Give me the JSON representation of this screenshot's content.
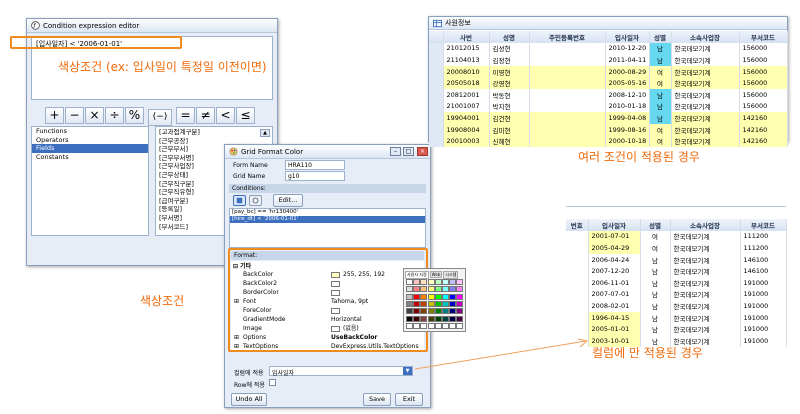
{
  "condition_editor": {
    "title": "Condition expression editor",
    "expression": "[입사일자] < '2006-01-01'",
    "operators": [
      "+",
      "−",
      "×",
      "÷",
      "%",
      "(−)",
      "=",
      "≠",
      "<",
      "≤"
    ],
    "categories": [
      "Functions",
      "Operators",
      "Fields",
      "Constants"
    ],
    "selected_category": "Fields",
    "fields": [
      "[고과접계구분]",
      "[근무공장]",
      "[근무부서]",
      "[근무부서명]",
      "[근무사업장]",
      "[근무상태]",
      "[근무직구분]",
      "[근무직유형]",
      "[급여구분]",
      "[등록일]",
      "[부서명]",
      "[부서코드]"
    ]
  },
  "grid_format": {
    "title": "Grid Format Color",
    "form_name_label": "Form Name",
    "form_name_value": "HRA110",
    "grid_name_label": "Grid Name",
    "grid_name_value": "g10",
    "conditions_header": "Conditions:",
    "edit_label": "Edit...",
    "conditions": [
      "[pay_bc] == 'hr130400'",
      "[hire_dt] < '2006-01-01'"
    ],
    "format_header": "Format:",
    "category": "기타",
    "props": [
      {
        "k": "BackColor",
        "v": "255, 255, 192",
        "swatch": "#ffffc0"
      },
      {
        "k": "BackColor2",
        "v": "",
        "swatch": "#ffffff"
      },
      {
        "k": "BorderColor",
        "v": "",
        "swatch": "#ffffff"
      },
      {
        "k": "Font",
        "v": "Tahoma, 9pt",
        "swatch": ""
      },
      {
        "k": "ForeColor",
        "v": "",
        "swatch": "#ffffff"
      },
      {
        "k": "GradientMode",
        "v": "Horizontal",
        "swatch": ""
      },
      {
        "k": "Image",
        "v": "(없음)",
        "swatch": "#ffffff"
      },
      {
        "k": "Options",
        "v": "UseBackColor",
        "swatch": ""
      },
      {
        "k": "TextOptions",
        "v": "DevExpress.Utils.TextOptions",
        "swatch": ""
      }
    ],
    "palette_tabs": [
      "사용자 지정",
      "Web",
      "시스템"
    ],
    "column_apply_label": "컬럼에 적용",
    "column_apply_value": "입사일자",
    "row_apply_label": "Row에 적용",
    "undo_all": "Undo All",
    "save": "Save",
    "exit": "Exit"
  },
  "employee_grid": {
    "title": "사원정보",
    "headers": [
      "사번",
      "성명",
      "주민등록번호",
      "입사일자",
      "성별",
      "소속사업장",
      "부서코드"
    ],
    "rows": [
      {
        "cells": [
          "21012015",
          "김성현",
          "",
          "2010-12-20",
          "남",
          "한국데모기계",
          "156000"
        ],
        "hl": false,
        "gender_hl": true
      },
      {
        "cells": [
          "21104013",
          "김정현",
          "",
          "2011-04-11",
          "남",
          "한국데모기계",
          "156000"
        ],
        "hl": false,
        "gender_hl": true
      },
      {
        "cells": [
          "20008010",
          "이영현",
          "",
          "2000-08-29",
          "여",
          "한국데모기계",
          "156000"
        ],
        "hl": true,
        "gender_hl": false
      },
      {
        "cells": [
          "20505018",
          "강영현",
          "",
          "2005-05-16",
          "여",
          "한국데모기계",
          "156000"
        ],
        "hl": true,
        "gender_hl": false
      },
      {
        "cells": [
          "20812001",
          "박동현",
          "",
          "2008-12-10",
          "남",
          "한국데모기계",
          "156000"
        ],
        "hl": false,
        "gender_hl": true
      },
      {
        "cells": [
          "21001007",
          "박지현",
          "",
          "2010-01-18",
          "남",
          "한국데모기계",
          "156000"
        ],
        "hl": false,
        "gender_hl": true
      },
      {
        "cells": [
          "19904001",
          "김건현",
          "",
          "1999-04-08",
          "남",
          "한국데모기계",
          "142160"
        ],
        "hl": true,
        "gender_hl": true
      },
      {
        "cells": [
          "19908004",
          "김미현",
          "",
          "1999-08-16",
          "여",
          "한국데모기계",
          "142160"
        ],
        "hl": true,
        "gender_hl": false
      },
      {
        "cells": [
          "20010003",
          "신혜현",
          "",
          "2000-10-18",
          "여",
          "한국데모기계",
          "142160"
        ],
        "hl": true,
        "gender_hl": false
      }
    ]
  },
  "column_grid": {
    "headers": [
      "번호",
      "입사일자",
      "성별",
      "소속사업장",
      "부서코드"
    ],
    "rows": [
      {
        "cells": [
          "",
          "2001-07-01",
          "여",
          "한국데모기계",
          "111200"
        ],
        "hl": true
      },
      {
        "cells": [
          "",
          "2005-04-29",
          "여",
          "한국데모기계",
          "111200"
        ],
        "hl": true
      },
      {
        "cells": [
          "",
          "2006-04-24",
          "남",
          "한국데모기계",
          "146100"
        ],
        "hl": false
      },
      {
        "cells": [
          "",
          "2007-12-20",
          "남",
          "한국데모기계",
          "146100"
        ],
        "hl": false
      },
      {
        "cells": [
          "",
          "2006-11-01",
          "남",
          "한국데모기계",
          "191000"
        ],
        "hl": false
      },
      {
        "cells": [
          "",
          "2007-07-01",
          "남",
          "한국데모기계",
          "191000"
        ],
        "hl": false
      },
      {
        "cells": [
          "",
          "2008-02-01",
          "남",
          "한국데모기계",
          "191000"
        ],
        "hl": false
      },
      {
        "cells": [
          "",
          "1996-04-15",
          "남",
          "한국데모기계",
          "191000"
        ],
        "hl": true
      },
      {
        "cells": [
          "",
          "2005-01-01",
          "남",
          "한국데모기계",
          "191000"
        ],
        "hl": true
      },
      {
        "cells": [
          "",
          "2003-10-01",
          "남",
          "한국데모기계",
          "191000"
        ],
        "hl": true
      }
    ]
  },
  "callouts": {
    "condition_example": "색상조건 (ex: 입사일이 특정일 이전이면)",
    "color_condition": "색상조건",
    "multi_applied": "여러 조건이 적용된 경우",
    "column_only": "컬럼에 만 적용된 경우"
  },
  "colors": {
    "accent_orange": "#f06a0a",
    "highlight_yellow": "#ffffb0",
    "highlight_cyan": "#66d9f0",
    "selection_blue": "#3d6fbf"
  }
}
